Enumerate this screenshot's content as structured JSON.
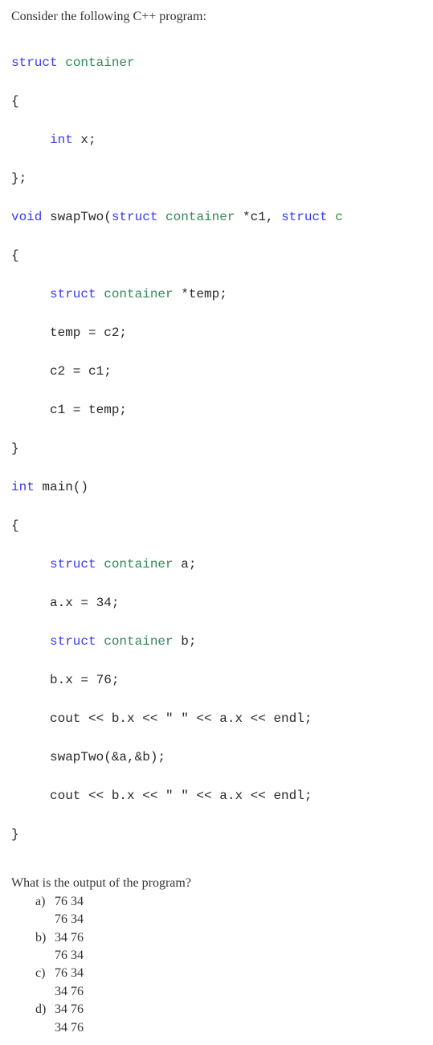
{
  "intro": "Consider the following C++ program:",
  "code": {
    "l1": "struct",
    "l1b": " container",
    "l2": "{",
    "l3_kw": "int",
    "l3_rest": " x;",
    "l4": "};",
    "l5_void": "void",
    "l5_fn": " swapTwo(",
    "l5_struct1": "struct",
    "l5_cont1": " container",
    "l5_ptr1": " *c1, ",
    "l5_struct2": "struct",
    "l5_cont2": " c",
    "l6": "{",
    "l7_struct": "struct",
    "l7_cont": " container",
    "l7_rest": " *temp;",
    "l8": "temp = c2;",
    "l9": "c2 = c1;",
    "l10": "c1 = temp;",
    "l11": "}",
    "l12_int": "int",
    "l12_main": " main()",
    "l13": "{",
    "l14_struct": "struct",
    "l14_cont": " container",
    "l14_rest": " a;",
    "l15": "a.x = 34;",
    "l16_struct": "struct",
    "l16_cont": " container",
    "l16_rest": " b;",
    "l17": "b.x = 76;",
    "l18": "cout << b.x << \" \" << a.x << endl;",
    "l19": "swapTwo(&a,&b);",
    "l20": "cout << b.x << \" \" << a.x << endl;",
    "l21": "}"
  },
  "question": "What is the output of the program?",
  "options": {
    "a": {
      "letter": "a)",
      "line1": "76 34",
      "line2": "76 34"
    },
    "b": {
      "letter": "b)",
      "line1": "34 76",
      "line2": "76 34"
    },
    "c": {
      "letter": "c)",
      "line1": "76 34",
      "line2": "34 76"
    },
    "d": {
      "letter": "d)",
      "line1": "34 76",
      "line2": "34 76"
    }
  }
}
